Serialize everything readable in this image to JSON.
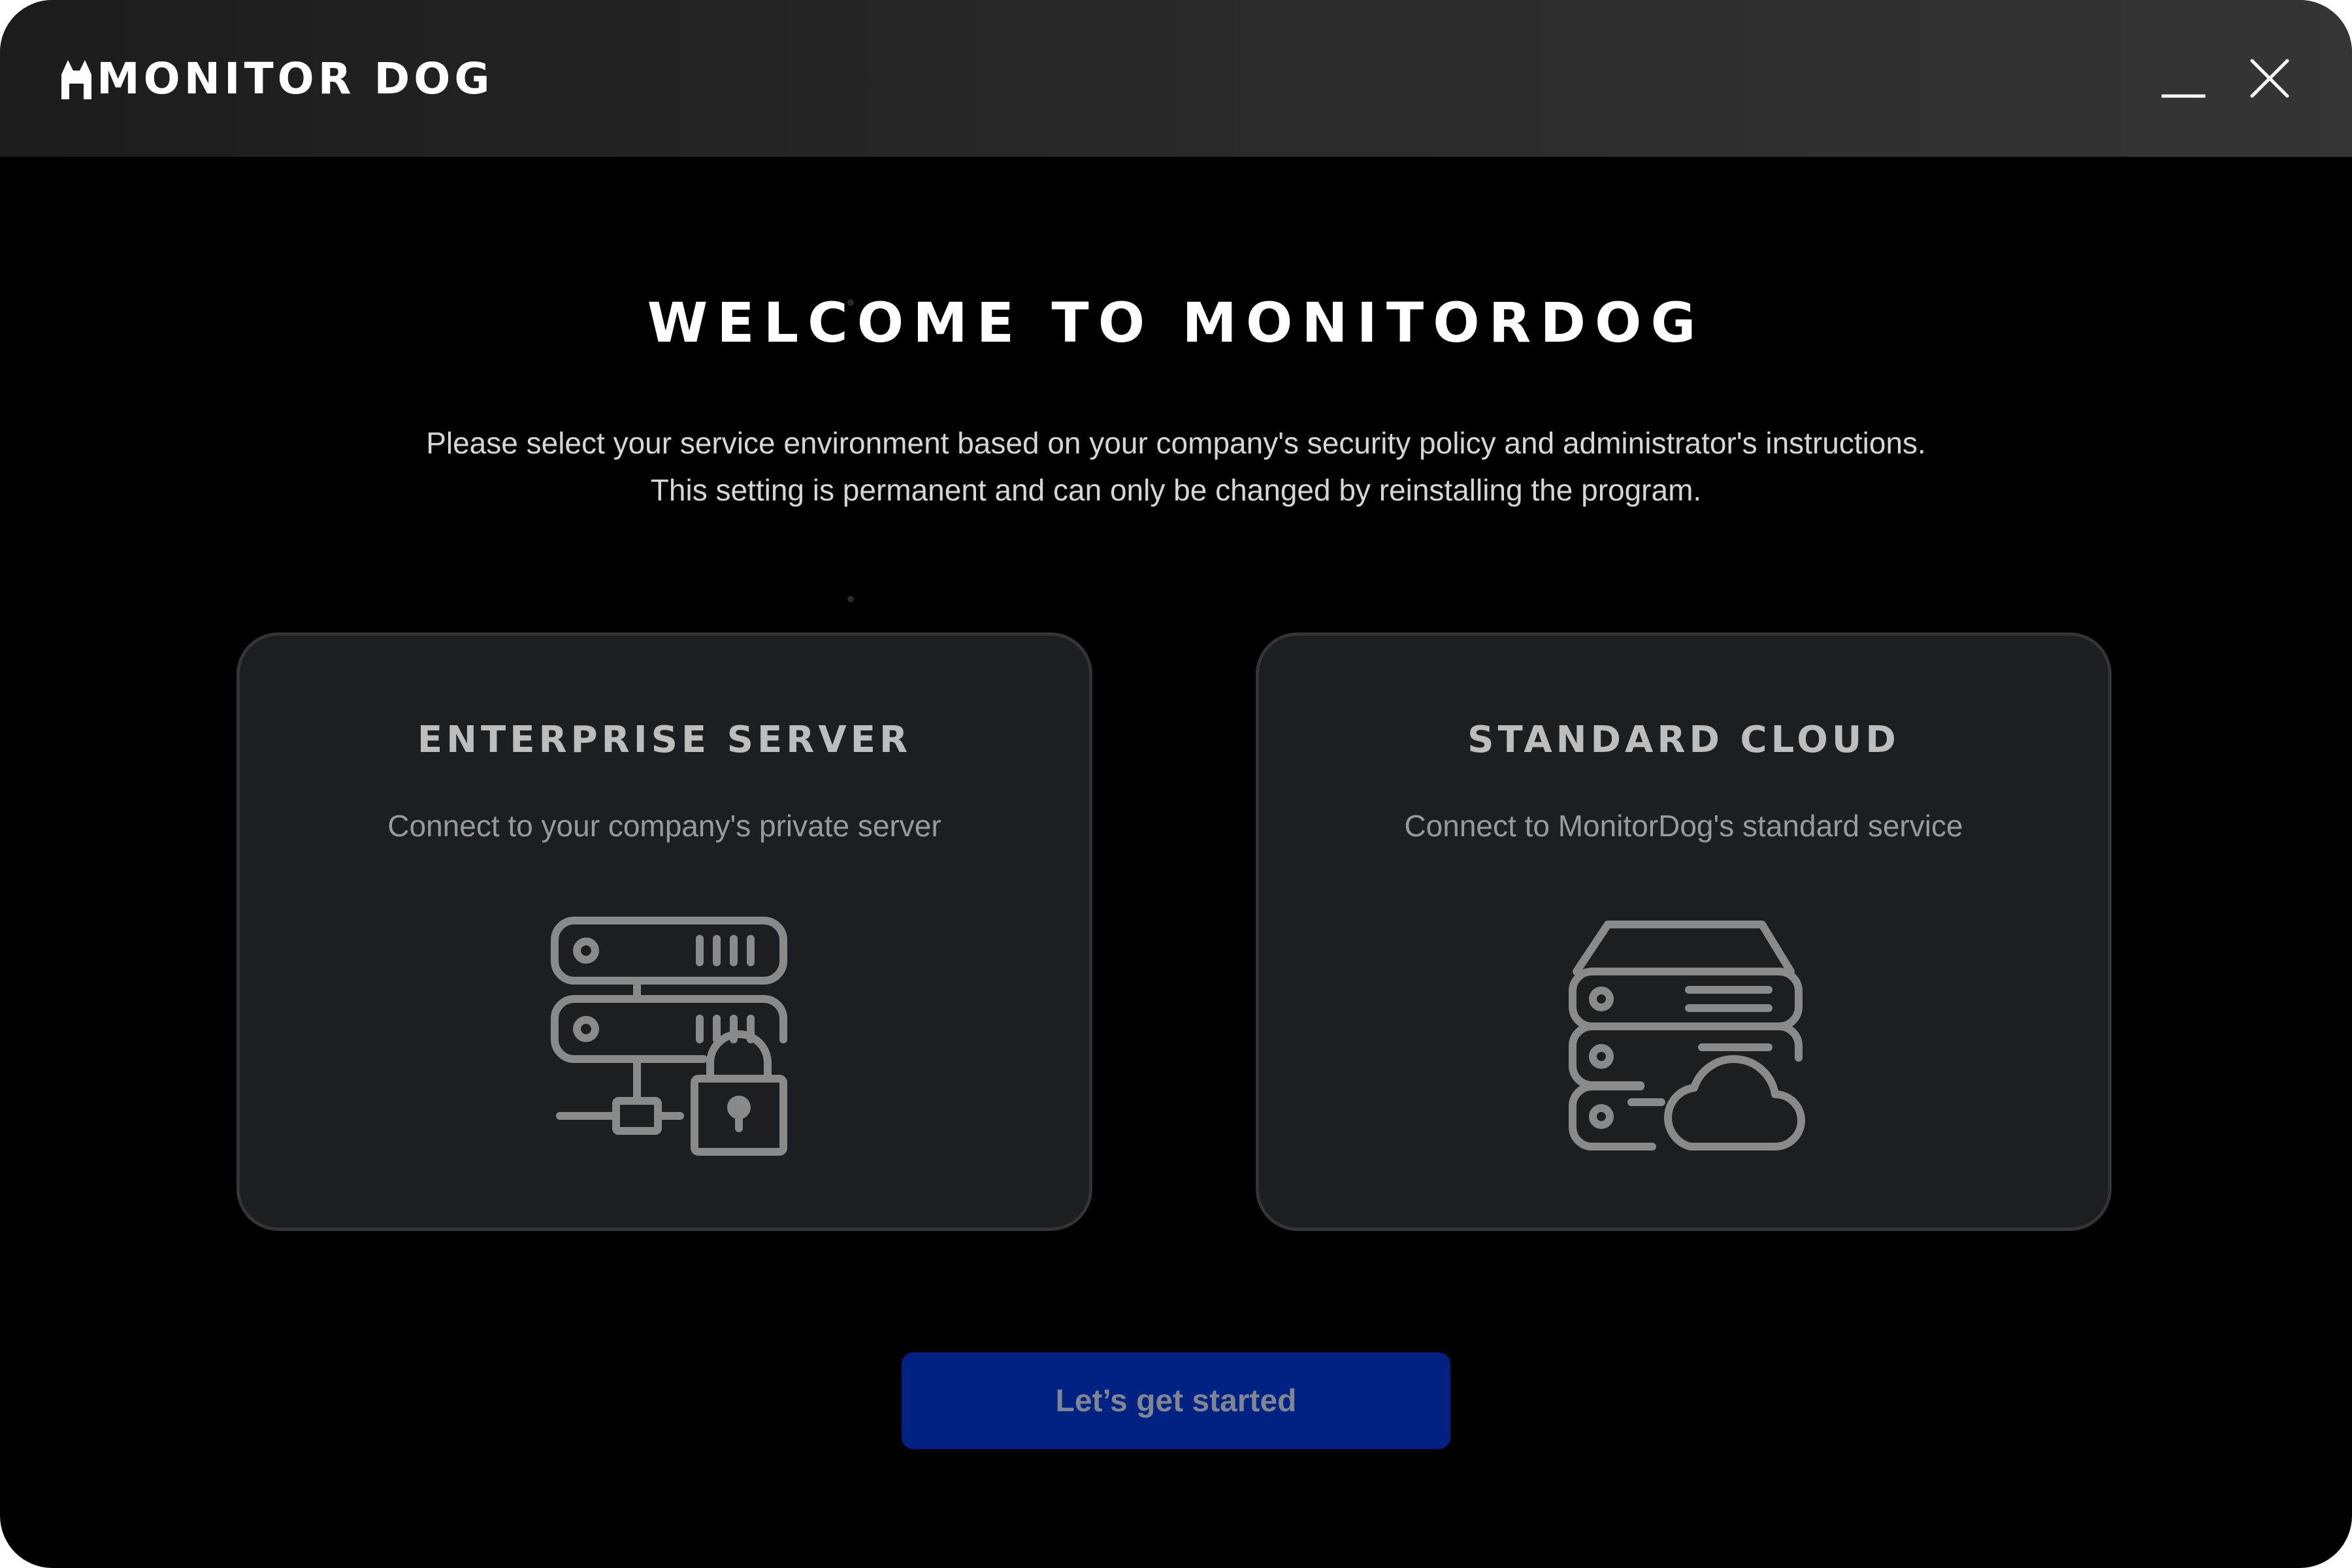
{
  "titlebar": {
    "brand_name": "MONITOR DOG",
    "minimize_icon": "minimize-icon",
    "close_icon": "close-icon"
  },
  "main": {
    "heading": "WELCOME TO MONITORDOG",
    "subtitle_line1": "Please select your service environment based on your company's security policy and administrator's instructions.",
    "subtitle_line2": "This setting is permanent and can only be changed by reinstalling the program."
  },
  "options": [
    {
      "title": "ENTERPRISE SERVER",
      "description": "Connect to your company's private server",
      "icon": "server-lock-icon"
    },
    {
      "title": "STANDARD CLOUD",
      "description": "Connect to MonitorDog's standard service",
      "icon": "server-cloud-icon"
    }
  ],
  "actions": {
    "start_label": "Let’s get started"
  },
  "colors": {
    "background": "#000000",
    "card_bg": "#1d1e20",
    "card_border": "#333436",
    "primary_button": "#022283",
    "button_text": "#7f8591",
    "icon_stroke": "#8a8a8a"
  }
}
